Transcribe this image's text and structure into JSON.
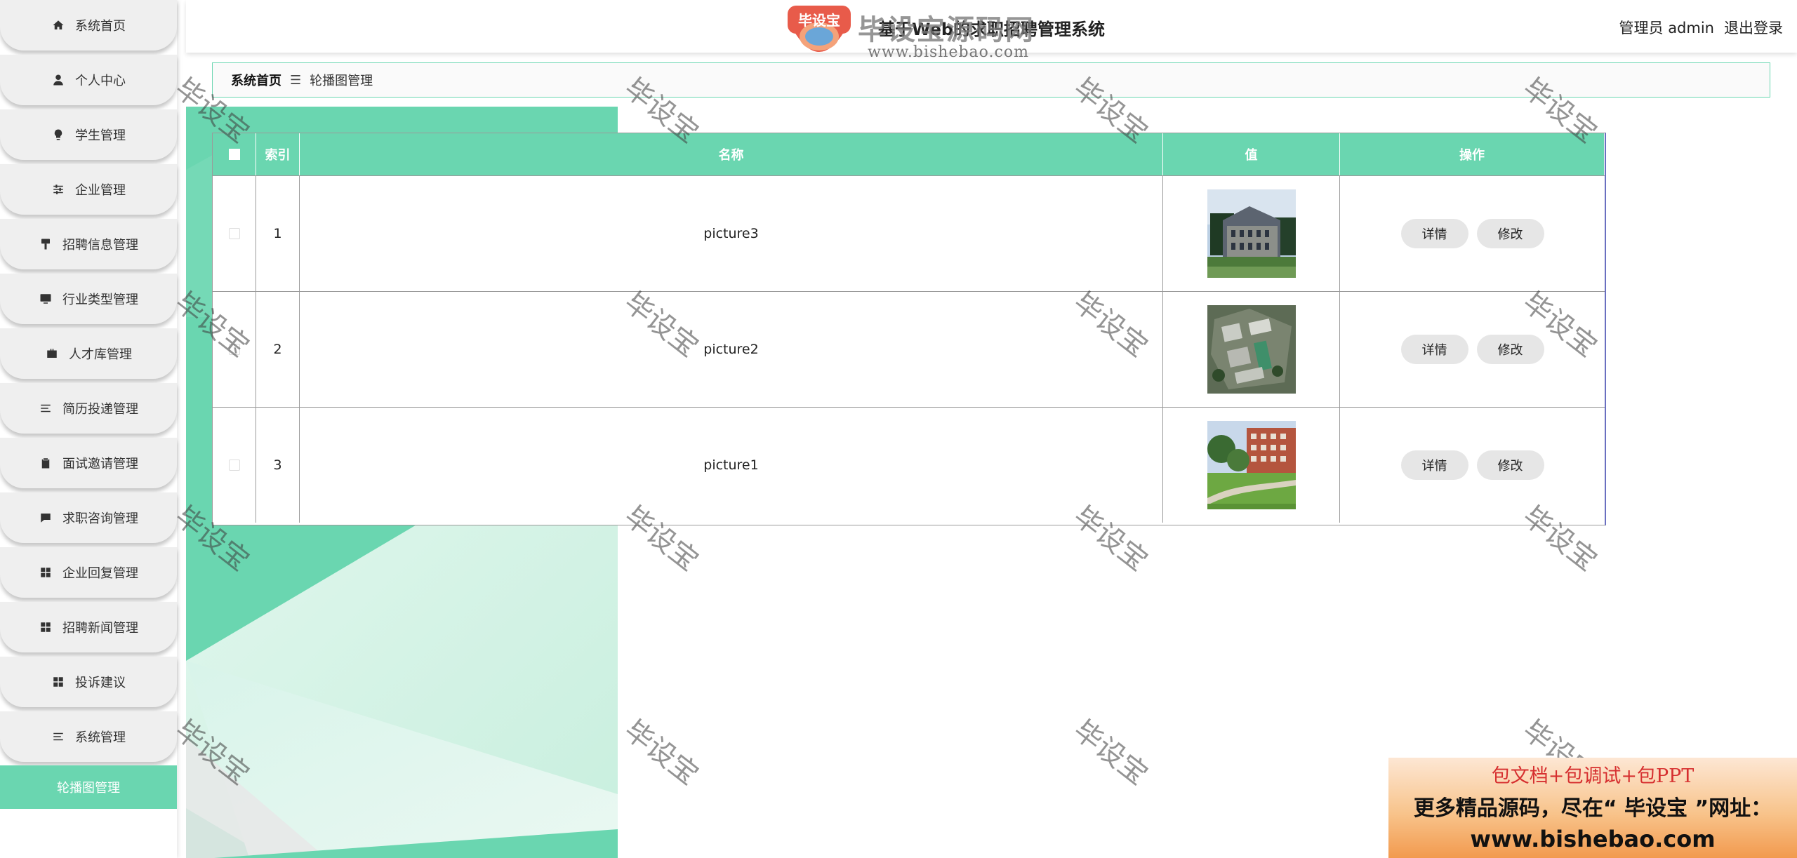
{
  "app": {
    "title": "基于Web的求职招聘管理系统",
    "user_label": "管理员 admin",
    "logout_label": "退出登录"
  },
  "sidebar": {
    "items": [
      {
        "label": "系统首页",
        "icon": "home-icon"
      },
      {
        "label": "个人中心",
        "icon": "user-icon"
      },
      {
        "label": "学生管理",
        "icon": "bulb-icon"
      },
      {
        "label": "企业管理",
        "icon": "sliders-icon"
      },
      {
        "label": "招聘信息管理",
        "icon": "brush-icon"
      },
      {
        "label": "行业类型管理",
        "icon": "monitor-icon"
      },
      {
        "label": "人才库管理",
        "icon": "briefcase-icon"
      },
      {
        "label": "简历投递管理",
        "icon": "list-icon"
      },
      {
        "label": "面试邀请管理",
        "icon": "clipboard-icon"
      },
      {
        "label": "求职咨询管理",
        "icon": "chat-icon"
      },
      {
        "label": "企业回复管理",
        "icon": "grid-icon"
      },
      {
        "label": "招聘新闻管理",
        "icon": "grid-icon"
      },
      {
        "label": "投诉建议",
        "icon": "grid-icon"
      },
      {
        "label": "系统管理",
        "icon": "list-icon"
      }
    ],
    "active_label": "轮播图管理"
  },
  "breadcrumb": {
    "home": "系统首页",
    "separator": "☰",
    "current": "轮播图管理"
  },
  "table": {
    "headers": {
      "index": "索引",
      "name": "名称",
      "value": "值",
      "actions": "操作"
    },
    "rows": [
      {
        "index": "1",
        "name": "picture3",
        "image": "building-photo"
      },
      {
        "index": "2",
        "name": "picture2",
        "image": "aerial-campus-photo"
      },
      {
        "index": "3",
        "name": "picture1",
        "image": "campus-lawn-photo"
      }
    ],
    "detail_label": "详情",
    "edit_label": "修改"
  },
  "watermark": {
    "text": "毕设宝"
  },
  "logo": {
    "badge_text": "毕设宝",
    "name": "毕设宝源码网",
    "url": "www.bishebao.com"
  },
  "ad": {
    "line1": "包文档+包调试+包PPT",
    "line2": "更多精品源码，尽在“ 毕设宝 ”网址：",
    "line3": "www.bishebao.com"
  },
  "colors": {
    "accent": "#6ad6b0",
    "nav_bg": "#efefef"
  }
}
